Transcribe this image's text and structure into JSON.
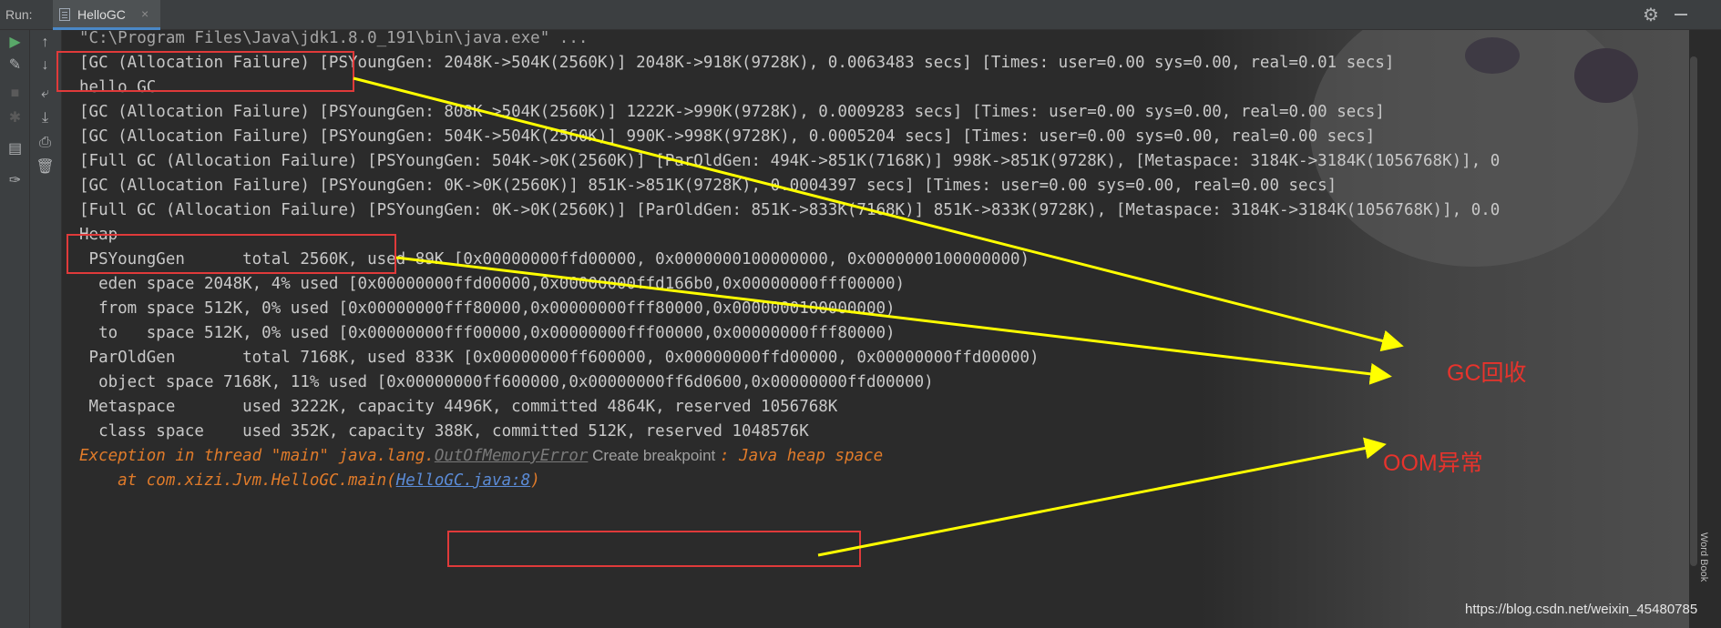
{
  "header": {
    "run_label": "Run:",
    "tab_title": "HelloGC",
    "tab_close": "×"
  },
  "icons": {
    "settings": "gear-icon",
    "minimize": "minimize-icon"
  },
  "console_lines": [
    "\"C:\\Program Files\\Java\\jdk1.8.0_191\\bin\\java.exe\" ...",
    "[GC (Allocation Failure) [PSYoungGen: 2048K->504K(2560K)] 2048K->918K(9728K), 0.0063483 secs] [Times: user=0.00 sys=0.00, real=0.01 secs]",
    "hello GC",
    "[GC (Allocation Failure) [PSYoungGen: 808K->504K(2560K)] 1222K->990K(9728K), 0.0009283 secs] [Times: user=0.00 sys=0.00, real=0.00 secs]",
    "[GC (Allocation Failure) [PSYoungGen: 504K->504K(2560K)] 990K->998K(9728K), 0.0005204 secs] [Times: user=0.00 sys=0.00, real=0.00 secs]",
    "[Full GC (Allocation Failure) [PSYoungGen: 504K->0K(2560K)] [ParOldGen: 494K->851K(7168K)] 998K->851K(9728K), [Metaspace: 3184K->3184K(1056768K)], 0",
    "[GC (Allocation Failure) [PSYoungGen: 0K->0K(2560K)] 851K->851K(9728K), 0.0004397 secs] [Times: user=0.00 sys=0.00, real=0.00 secs]",
    "[Full GC (Allocation Failure) [PSYoungGen: 0K->0K(2560K)] [ParOldGen: 851K->833K(7168K)] 851K->833K(9728K), [Metaspace: 3184K->3184K(1056768K)], 0.0",
    "Heap",
    " PSYoungGen      total 2560K, used 89K [0x00000000ffd00000, 0x0000000100000000, 0x0000000100000000)",
    "  eden space 2048K, 4% used [0x00000000ffd00000,0x00000000ffd166b0,0x00000000fff00000)",
    "  from space 512K, 0% used [0x00000000fff80000,0x00000000fff80000,0x0000000100000000)",
    "  to   space 512K, 0% used [0x00000000fff00000,0x00000000fff00000,0x00000000fff80000)",
    " ParOldGen       total 7168K, used 833K [0x00000000ff600000, 0x00000000ffd00000, 0x00000000ffd00000)",
    "  object space 7168K, 11% used [0x00000000ff600000,0x00000000ff6d0600,0x00000000ffd00000)",
    " Metaspace       used 3222K, capacity 4496K, committed 4864K, reserved 1056768K",
    "  class space    used 352K, capacity 388K, committed 512K, reserved 1048576K"
  ],
  "exception": {
    "prefix": "Exception in thread \"main\" java.lang.",
    "error_class": "OutOfMemoryError",
    "tooltip": " Create breakpoint ",
    "suffix": ": Java heap space",
    "at_prefix": "    at com.xizi.Jvm.HelloGC.main(",
    "link": "HelloGC.java:8",
    "at_suffix": ")"
  },
  "annotations": {
    "gc_label": "GC回收",
    "oom_label": "OOM异常"
  },
  "side_panel": {
    "word_book": "Word Book"
  },
  "watermark": "https://blog.csdn.net/weixin_45480785",
  "colors": {
    "annotation_red": "#e8332c",
    "arrow_yellow": "#ffff00",
    "exception_orange": "#e07b2a",
    "link_blue": "#5b8bd6"
  }
}
